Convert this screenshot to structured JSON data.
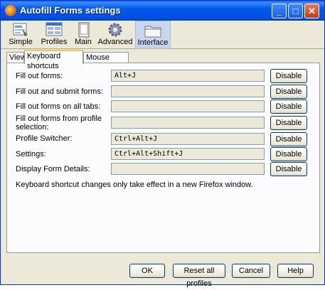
{
  "window": {
    "title": "Autofill Forms settings"
  },
  "titlebar_buttons": {
    "minimize": "_",
    "maximize": "□",
    "close": "✕"
  },
  "toolbar": [
    {
      "label": "Simple",
      "icon": "simple-form-icon"
    },
    {
      "label": "Profiles",
      "icon": "profiles-icon"
    },
    {
      "label": "Main",
      "icon": "main-window-icon"
    },
    {
      "label": "Advanced",
      "icon": "gear-icon"
    },
    {
      "label": "Interface",
      "icon": "folder-icon",
      "active": true
    }
  ],
  "tabs": [
    {
      "label": "View"
    },
    {
      "label": "Keyboard shortcuts",
      "active": true
    },
    {
      "label": "Mouse buttons"
    }
  ],
  "shortcuts": [
    {
      "label": "Fill out forms:",
      "value": "Alt+J",
      "button": "Disable"
    },
    {
      "label": "Fill out and submit forms:",
      "value": "",
      "button": "Disable"
    },
    {
      "label": "Fill out forms on all tabs:",
      "value": "",
      "button": "Disable"
    },
    {
      "label": "Fill out forms from profile selection:",
      "value": "",
      "button": "Disable"
    },
    {
      "label": "Profile Switcher:",
      "value": "Ctrl+Alt+J",
      "button": "Disable"
    },
    {
      "label": "Settings:",
      "value": "Ctrl+Alt+Shift+J",
      "button": "Disable"
    },
    {
      "label": "Display Form Details:",
      "value": "",
      "button": "Disable"
    }
  ],
  "note": "Keyboard shortcut changes only take effect in a new Firefox window.",
  "footer": {
    "ok": "OK",
    "reset": "Reset all profiles",
    "cancel": "Cancel",
    "help": "Help"
  },
  "colors": {
    "accent": "#0058ee",
    "dialog_bg": "#ece9d8",
    "tab_highlight": "#f7c34a"
  }
}
